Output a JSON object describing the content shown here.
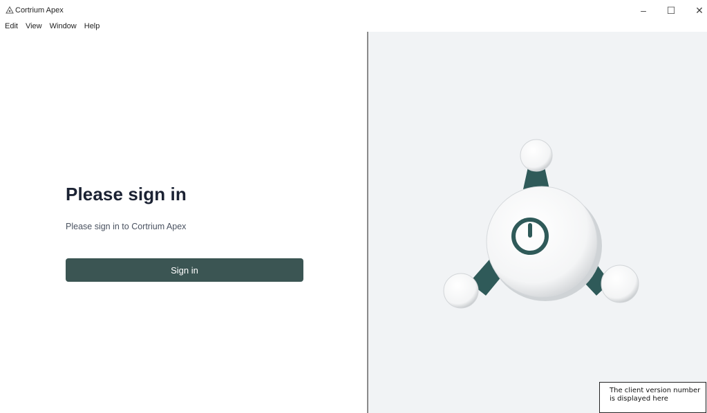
{
  "window": {
    "title": "Cortrium Apex",
    "controls": {
      "minimize": "–",
      "maximize": "☐",
      "close": "✕"
    }
  },
  "menu": [
    "Edit",
    "View",
    "Window",
    "Help"
  ],
  "signin": {
    "heading": "Please sign in",
    "subtext": "Please sign in to Cortrium Apex",
    "button_label": "Sign in"
  },
  "version_note": "The client version number is displayed here",
  "colors": {
    "accent": "#3b5553",
    "device_teal": "#2f5a59",
    "right_pane_bg": "#f1f3f5"
  },
  "icons": {
    "app": "app-logo-icon",
    "device": "power-device-illustration"
  }
}
